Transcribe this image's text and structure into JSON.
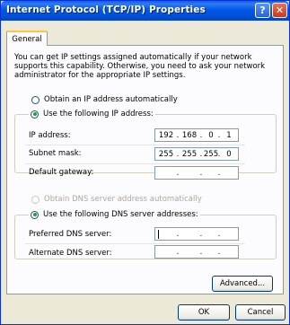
{
  "window": {
    "title": "Internet Protocol (TCP/IP) Properties",
    "help_glyph": "?",
    "close_glyph": "✕"
  },
  "tabs": [
    {
      "label": "General",
      "active": true
    }
  ],
  "intro_text": "You can get IP settings assigned automatically if your network supports this capability. Otherwise, you need to ask your network administrator for the appropriate IP settings.",
  "ip_section": {
    "auto_option": "Obtain an IP address automatically",
    "manual_option": "Use the following IP address:",
    "selected": "manual",
    "fields": [
      {
        "label": "IP address:",
        "octets": [
          "192",
          "168",
          "0",
          "1"
        ]
      },
      {
        "label": "Subnet mask:",
        "octets": [
          "255",
          "255",
          "255",
          "0"
        ]
      },
      {
        "label": "Default gateway:",
        "octets": [
          "",
          "",
          "",
          ""
        ]
      }
    ]
  },
  "dns_section": {
    "auto_option": "Obtain DNS server address automatically",
    "manual_option": "Use the following DNS server addresses:",
    "selected": "manual",
    "fields": [
      {
        "label": "Preferred DNS server:",
        "octets": [
          "",
          "",
          "",
          ""
        ]
      },
      {
        "label": "Alternate DNS server:",
        "octets": [
          "",
          "",
          "",
          ""
        ]
      }
    ]
  },
  "separator_dot": ".",
  "buttons": {
    "advanced": "Advanced...",
    "ok": "OK",
    "cancel": "Cancel"
  },
  "colors": {
    "titlebar": "#0058e6",
    "dialog_bg": "#ece9d8",
    "panel_bg": "#fcfcfe",
    "radio_dot": "#21a121",
    "close_button": "#c63a18"
  }
}
